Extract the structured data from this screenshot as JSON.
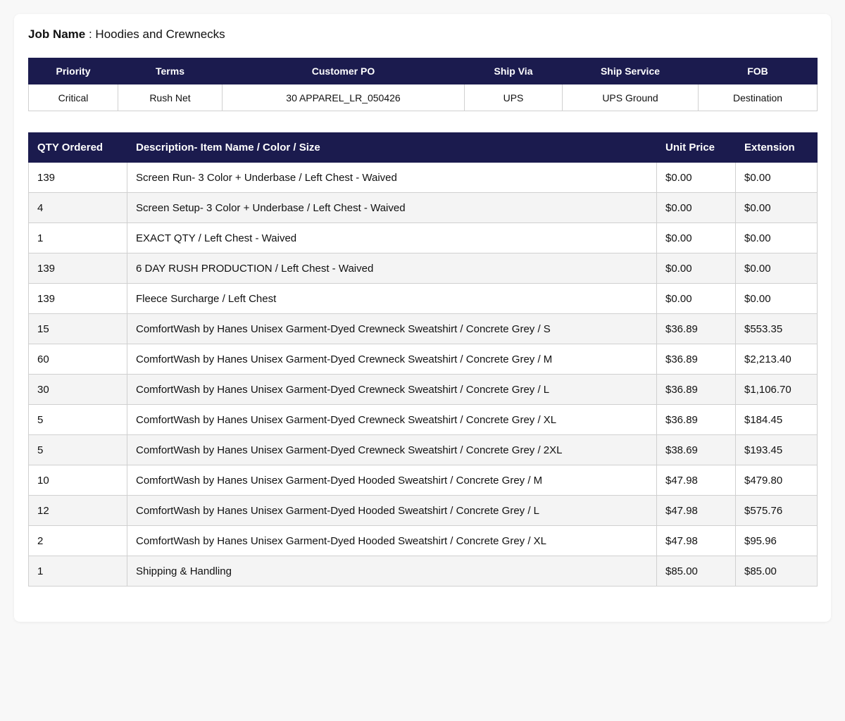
{
  "job": {
    "label": "Job Name",
    "separator": " : ",
    "value": "Hoodies and Crewnecks"
  },
  "info": {
    "headers": {
      "priority": "Priority",
      "terms": "Terms",
      "customer_po": "Customer PO",
      "ship_via": "Ship Via",
      "ship_service": "Ship Service",
      "fob": "FOB"
    },
    "values": {
      "priority": "Critical",
      "terms": "Rush Net",
      "customer_po": "30 APPAREL_LR_050426",
      "ship_via": "UPS",
      "ship_service": "UPS Ground",
      "fob": "Destination"
    }
  },
  "items": {
    "headers": {
      "qty": "QTY Ordered",
      "description": "Description- Item Name / Color / Size",
      "unit_price": "Unit Price",
      "extension": "Extension"
    },
    "rows": [
      {
        "qty": "139",
        "description": "Screen Run- 3 Color + Underbase / Left Chest - Waived",
        "unit_price": "$0.00",
        "extension": "$0.00"
      },
      {
        "qty": "4",
        "description": "Screen Setup- 3 Color + Underbase / Left Chest - Waived",
        "unit_price": "$0.00",
        "extension": "$0.00"
      },
      {
        "qty": "1",
        "description": "EXACT QTY / Left Chest - Waived",
        "unit_price": "$0.00",
        "extension": "$0.00"
      },
      {
        "qty": "139",
        "description": "6 DAY RUSH PRODUCTION / Left Chest - Waived",
        "unit_price": "$0.00",
        "extension": "$0.00"
      },
      {
        "qty": "139",
        "description": "Fleece Surcharge / Left Chest",
        "unit_price": "$0.00",
        "extension": "$0.00"
      },
      {
        "qty": "15",
        "description": "ComfortWash by Hanes Unisex Garment-Dyed Crewneck Sweatshirt / Concrete Grey / S",
        "unit_price": "$36.89",
        "extension": "$553.35"
      },
      {
        "qty": "60",
        "description": "ComfortWash by Hanes Unisex Garment-Dyed Crewneck Sweatshirt / Concrete Grey / M",
        "unit_price": "$36.89",
        "extension": "$2,213.40"
      },
      {
        "qty": "30",
        "description": "ComfortWash by Hanes Unisex Garment-Dyed Crewneck Sweatshirt / Concrete Grey / L",
        "unit_price": "$36.89",
        "extension": "$1,106.70"
      },
      {
        "qty": "5",
        "description": "ComfortWash by Hanes Unisex Garment-Dyed Crewneck Sweatshirt / Concrete Grey / XL",
        "unit_price": "$36.89",
        "extension": "$184.45"
      },
      {
        "qty": "5",
        "description": "ComfortWash by Hanes Unisex Garment-Dyed Crewneck Sweatshirt / Concrete Grey / 2XL",
        "unit_price": "$38.69",
        "extension": "$193.45"
      },
      {
        "qty": "10",
        "description": "ComfortWash by Hanes Unisex Garment-Dyed Hooded Sweatshirt / Concrete Grey / M",
        "unit_price": "$47.98",
        "extension": "$479.80"
      },
      {
        "qty": "12",
        "description": "ComfortWash by Hanes Unisex Garment-Dyed Hooded Sweatshirt / Concrete Grey / L",
        "unit_price": "$47.98",
        "extension": "$575.76"
      },
      {
        "qty": "2",
        "description": "ComfortWash by Hanes Unisex Garment-Dyed Hooded Sweatshirt / Concrete Grey / XL",
        "unit_price": "$47.98",
        "extension": "$95.96"
      },
      {
        "qty": "1",
        "description": "Shipping & Handling",
        "unit_price": "$85.00",
        "extension": "$85.00"
      }
    ]
  },
  "colors": {
    "header_bg": "#1b1b4e",
    "header_text": "#ffffff",
    "row_alt_bg": "#f4f4f4",
    "page_bg": "#f8f8f8"
  }
}
